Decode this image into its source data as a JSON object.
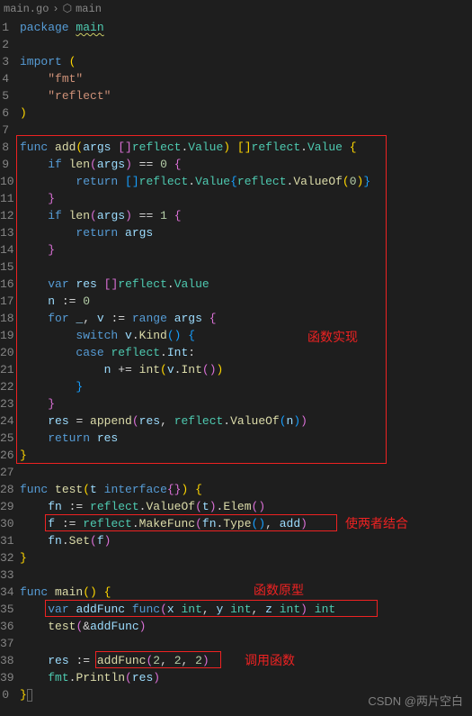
{
  "breadcrumb": {
    "file": "main.go",
    "symbol": "main"
  },
  "gutter_start": 1,
  "lines": [
    [
      [
        "kw",
        "package "
      ],
      [
        "pkg-u",
        "main"
      ]
    ],
    [],
    [
      [
        "kw",
        "import "
      ],
      [
        "paren-y",
        "("
      ]
    ],
    [
      [
        "white",
        "    "
      ],
      [
        "str",
        "\"fmt\""
      ]
    ],
    [
      [
        "white",
        "    "
      ],
      [
        "str",
        "\"reflect\""
      ]
    ],
    [
      [
        "paren-y",
        ")"
      ]
    ],
    [],
    [
      [
        "kw",
        "func "
      ],
      [
        "fn",
        "add"
      ],
      [
        "paren-y",
        "("
      ],
      [
        "var",
        "args "
      ],
      [
        "paren-p",
        "[]"
      ],
      [
        "type",
        "reflect"
      ],
      [
        "white",
        "."
      ],
      [
        "type",
        "Value"
      ],
      [
        "paren-y",
        ") "
      ],
      [
        "paren-y",
        "[]"
      ],
      [
        "type",
        "reflect"
      ],
      [
        "white",
        "."
      ],
      [
        "type",
        "Value "
      ],
      [
        "paren-y",
        "{"
      ]
    ],
    [
      [
        "white",
        "    "
      ],
      [
        "kw",
        "if "
      ],
      [
        "fn",
        "len"
      ],
      [
        "paren-p",
        "("
      ],
      [
        "var",
        "args"
      ],
      [
        "paren-p",
        ") "
      ],
      [
        "white",
        "== "
      ],
      [
        "num",
        "0 "
      ],
      [
        "paren-p",
        "{"
      ]
    ],
    [
      [
        "white",
        "        "
      ],
      [
        "kw",
        "return "
      ],
      [
        "paren-b",
        "[]"
      ],
      [
        "type",
        "reflect"
      ],
      [
        "white",
        "."
      ],
      [
        "type",
        "Value"
      ],
      [
        "paren-b",
        "{"
      ],
      [
        "type",
        "reflect"
      ],
      [
        "white",
        "."
      ],
      [
        "fn",
        "ValueOf"
      ],
      [
        "paren-y",
        "("
      ],
      [
        "num",
        "0"
      ],
      [
        "paren-y",
        ")"
      ],
      [
        "paren-b",
        "}"
      ]
    ],
    [
      [
        "white",
        "    "
      ],
      [
        "paren-p",
        "}"
      ]
    ],
    [
      [
        "white",
        "    "
      ],
      [
        "kw",
        "if "
      ],
      [
        "fn",
        "len"
      ],
      [
        "paren-p",
        "("
      ],
      [
        "var",
        "args"
      ],
      [
        "paren-p",
        ") "
      ],
      [
        "white",
        "== "
      ],
      [
        "num",
        "1 "
      ],
      [
        "paren-p",
        "{"
      ]
    ],
    [
      [
        "white",
        "        "
      ],
      [
        "kw",
        "return "
      ],
      [
        "var",
        "args"
      ]
    ],
    [
      [
        "white",
        "    "
      ],
      [
        "paren-p",
        "}"
      ]
    ],
    [],
    [
      [
        "white",
        "    "
      ],
      [
        "kw",
        "var "
      ],
      [
        "var",
        "res "
      ],
      [
        "paren-p",
        "[]"
      ],
      [
        "type",
        "reflect"
      ],
      [
        "white",
        "."
      ],
      [
        "type",
        "Value"
      ]
    ],
    [
      [
        "white",
        "    "
      ],
      [
        "var",
        "n "
      ],
      [
        "white",
        ":= "
      ],
      [
        "num",
        "0"
      ]
    ],
    [
      [
        "white",
        "    "
      ],
      [
        "kw",
        "for "
      ],
      [
        "var",
        "_"
      ],
      [
        "white",
        ", "
      ],
      [
        "var",
        "v "
      ],
      [
        "white",
        ":= "
      ],
      [
        "kw",
        "range "
      ],
      [
        "var",
        "args "
      ],
      [
        "paren-p",
        "{"
      ]
    ],
    [
      [
        "white",
        "        "
      ],
      [
        "kw",
        "switch "
      ],
      [
        "var",
        "v"
      ],
      [
        "white",
        "."
      ],
      [
        "fn",
        "Kind"
      ],
      [
        "paren-b",
        "() "
      ],
      [
        "paren-b",
        "{"
      ]
    ],
    [
      [
        "white",
        "        "
      ],
      [
        "kw",
        "case "
      ],
      [
        "type",
        "reflect"
      ],
      [
        "white",
        "."
      ],
      [
        "var",
        "Int"
      ],
      [
        "white",
        ":"
      ]
    ],
    [
      [
        "white",
        "            "
      ],
      [
        "var",
        "n "
      ],
      [
        "white",
        "+= "
      ],
      [
        "fn",
        "int"
      ],
      [
        "paren-y",
        "("
      ],
      [
        "var",
        "v"
      ],
      [
        "white",
        "."
      ],
      [
        "fn",
        "Int"
      ],
      [
        "paren-p",
        "()"
      ],
      [
        "paren-y",
        ")"
      ]
    ],
    [
      [
        "white",
        "        "
      ],
      [
        "paren-b",
        "}"
      ]
    ],
    [
      [
        "white",
        "    "
      ],
      [
        "paren-p",
        "}"
      ]
    ],
    [
      [
        "white",
        "    "
      ],
      [
        "var",
        "res "
      ],
      [
        "white",
        "= "
      ],
      [
        "fn",
        "append"
      ],
      [
        "paren-p",
        "("
      ],
      [
        "var",
        "res"
      ],
      [
        "white",
        ", "
      ],
      [
        "type",
        "reflect"
      ],
      [
        "white",
        "."
      ],
      [
        "fn",
        "ValueOf"
      ],
      [
        "paren-b",
        "("
      ],
      [
        "var",
        "n"
      ],
      [
        "paren-b",
        ")"
      ],
      [
        "paren-p",
        ")"
      ]
    ],
    [
      [
        "white",
        "    "
      ],
      [
        "kw",
        "return "
      ],
      [
        "var",
        "res"
      ]
    ],
    [
      [
        "paren-y",
        "}"
      ]
    ],
    [],
    [
      [
        "kw",
        "func "
      ],
      [
        "fn",
        "test"
      ],
      [
        "paren-y",
        "("
      ],
      [
        "var",
        "t "
      ],
      [
        "kw",
        "interface"
      ],
      [
        "paren-p",
        "{}"
      ],
      [
        "paren-y",
        ") "
      ],
      [
        "paren-y",
        "{"
      ]
    ],
    [
      [
        "white",
        "    "
      ],
      [
        "var",
        "fn "
      ],
      [
        "white",
        ":= "
      ],
      [
        "type",
        "reflect"
      ],
      [
        "white",
        "."
      ],
      [
        "fn",
        "ValueOf"
      ],
      [
        "paren-p",
        "("
      ],
      [
        "var",
        "t"
      ],
      [
        "paren-p",
        ")"
      ],
      [
        "white",
        "."
      ],
      [
        "fn",
        "Elem"
      ],
      [
        "paren-p",
        "()"
      ]
    ],
    [
      [
        "white",
        "    "
      ],
      [
        "var",
        "f "
      ],
      [
        "white",
        ":= "
      ],
      [
        "type",
        "reflect"
      ],
      [
        "white",
        "."
      ],
      [
        "fn",
        "MakeFunc"
      ],
      [
        "paren-p",
        "("
      ],
      [
        "var",
        "fn"
      ],
      [
        "white",
        "."
      ],
      [
        "fn",
        "Type"
      ],
      [
        "paren-b",
        "()"
      ],
      [
        "white",
        ", "
      ],
      [
        "var",
        "add"
      ],
      [
        "paren-p",
        ")"
      ]
    ],
    [
      [
        "white",
        "    "
      ],
      [
        "var",
        "fn"
      ],
      [
        "white",
        "."
      ],
      [
        "fn",
        "Set"
      ],
      [
        "paren-p",
        "("
      ],
      [
        "var",
        "f"
      ],
      [
        "paren-p",
        ")"
      ]
    ],
    [
      [
        "paren-y",
        "}"
      ]
    ],
    [],
    [
      [
        "kw",
        "func "
      ],
      [
        "fn",
        "main"
      ],
      [
        "paren-y",
        "() {"
      ]
    ],
    [
      [
        "white",
        "    "
      ],
      [
        "kw",
        "var "
      ],
      [
        "var",
        "addFunc "
      ],
      [
        "kw",
        "func"
      ],
      [
        "paren-p",
        "("
      ],
      [
        "var",
        "x "
      ],
      [
        "type",
        "int"
      ],
      [
        "white",
        ", "
      ],
      [
        "var",
        "y "
      ],
      [
        "type",
        "int"
      ],
      [
        "white",
        ", "
      ],
      [
        "var",
        "z "
      ],
      [
        "type",
        "int"
      ],
      [
        "paren-p",
        ") "
      ],
      [
        "type",
        "int"
      ]
    ],
    [
      [
        "white",
        "    "
      ],
      [
        "fn",
        "test"
      ],
      [
        "paren-p",
        "("
      ],
      [
        "white",
        "&"
      ],
      [
        "var",
        "addFunc"
      ],
      [
        "paren-p",
        ")"
      ]
    ],
    [],
    [
      [
        "white",
        "    "
      ],
      [
        "var",
        "res "
      ],
      [
        "white",
        ":= "
      ],
      [
        "fn",
        "addFunc"
      ],
      [
        "paren-p",
        "("
      ],
      [
        "num",
        "2"
      ],
      [
        "white",
        ", "
      ],
      [
        "num",
        "2"
      ],
      [
        "white",
        ", "
      ],
      [
        "num",
        "2"
      ],
      [
        "paren-p",
        ")"
      ]
    ],
    [
      [
        "white",
        "    "
      ],
      [
        "type",
        "fmt"
      ],
      [
        "white",
        "."
      ],
      [
        "fn",
        "Println"
      ],
      [
        "paren-p",
        "("
      ],
      [
        "var",
        "res"
      ],
      [
        "paren-p",
        ")"
      ]
    ],
    [
      [
        "paren-y",
        "}"
      ]
    ]
  ],
  "gutter_truncated_last": "0",
  "annotations": {
    "impl": "函数实现",
    "combine": "使两者结合",
    "proto": "函数原型",
    "call": "调用函数"
  },
  "watermark": "CSDN @两片空白"
}
